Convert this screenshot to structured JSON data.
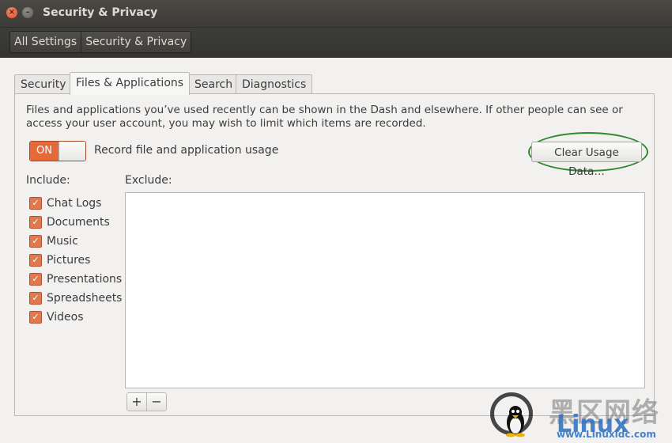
{
  "window": {
    "title": "Security & Privacy",
    "close_glyph": "×",
    "minimize_glyph": "–"
  },
  "toolbar": {
    "breadcrumbs": [
      "All Settings",
      "Security & Privacy"
    ]
  },
  "tabs": [
    {
      "label": "Security",
      "active": false
    },
    {
      "label": "Files & Applications",
      "active": true
    },
    {
      "label": "Search",
      "active": false
    },
    {
      "label": "Diagnostics",
      "active": false
    }
  ],
  "files_tab": {
    "description": "Files and applications you’ve used recently can be shown in the Dash and elsewhere. If other people can see or access your user account, you may wish to limit which items are recorded.",
    "toggle": {
      "state_label": "ON",
      "label": "Record file and application usage"
    },
    "clear_button_label": "Clear Usage Data…",
    "include_label": "Include:",
    "exclude_label": "Exclude:",
    "include_items": [
      "Chat Logs",
      "Documents",
      "Music",
      "Pictures",
      "Presentations",
      "Spreadsheets",
      "Videos"
    ],
    "check_glyph": "✓",
    "add_label": "+",
    "remove_label": "−"
  },
  "watermark": {
    "cn_text": "黑区网络",
    "word": "Linux",
    "url": "www.Linuxidc.com"
  },
  "colors": {
    "accent": "#e56a3b",
    "highlight": "#2e8a2e"
  }
}
